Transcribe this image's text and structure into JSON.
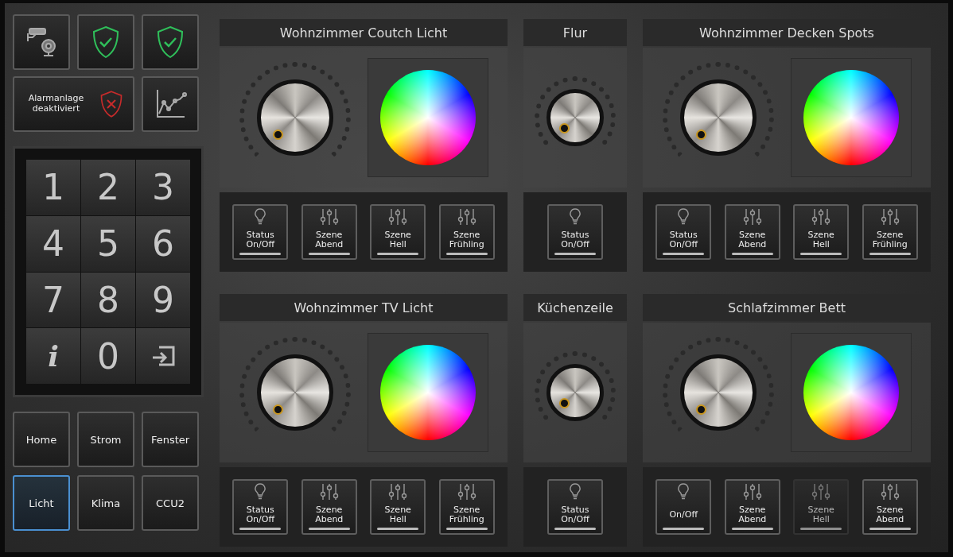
{
  "status_tiles": [
    {
      "kind": "camera"
    },
    {
      "kind": "shield_ok"
    },
    {
      "kind": "shield_ok"
    }
  ],
  "alarm": {
    "label": "Alarmanlage deaktiviert",
    "armed": false
  },
  "keypad": [
    {
      "kind": "digit",
      "label": "1"
    },
    {
      "kind": "digit",
      "label": "2"
    },
    {
      "kind": "digit",
      "label": "3"
    },
    {
      "kind": "digit",
      "label": "4"
    },
    {
      "kind": "digit",
      "label": "5"
    },
    {
      "kind": "digit",
      "label": "6"
    },
    {
      "kind": "digit",
      "label": "7"
    },
    {
      "kind": "digit",
      "label": "8"
    },
    {
      "kind": "digit",
      "label": "9"
    },
    {
      "kind": "info",
      "label": "i"
    },
    {
      "kind": "digit",
      "label": "0"
    },
    {
      "kind": "enter"
    }
  ],
  "nav": [
    {
      "label": "Home",
      "selected": false
    },
    {
      "label": "Strom",
      "selected": false
    },
    {
      "label": "Fenster",
      "selected": false
    },
    {
      "label": "Licht",
      "selected": true
    },
    {
      "label": "Klima",
      "selected": false
    },
    {
      "label": "CCU2",
      "selected": false
    }
  ],
  "rooms": [
    {
      "title": "Wohnzimmer Coutch Licht",
      "color_wheel": true,
      "buttons": [
        {
          "kind": "bulb",
          "label": "Status\nOn/Off",
          "disabled": false
        },
        {
          "kind": "scene",
          "label": "Szene\nAbend",
          "disabled": false
        },
        {
          "kind": "scene",
          "label": "Szene\nHell",
          "disabled": false
        },
        {
          "kind": "scene",
          "label": "Szene\nFrühling",
          "disabled": false
        }
      ]
    },
    {
      "title": "Flur",
      "color_wheel": false,
      "buttons": [
        {
          "kind": "bulb",
          "label": "Status\nOn/Off",
          "disabled": false
        }
      ]
    },
    {
      "title": "Wohnzimmer Decken Spots",
      "color_wheel": true,
      "buttons": [
        {
          "kind": "bulb",
          "label": "Status\nOn/Off",
          "disabled": false
        },
        {
          "kind": "scene",
          "label": "Szene\nAbend",
          "disabled": false
        },
        {
          "kind": "scene",
          "label": "Szene\nHell",
          "disabled": false
        },
        {
          "kind": "scene",
          "label": "Szene\nFrühling",
          "disabled": false
        }
      ]
    },
    {
      "title": "Wohnzimmer TV Licht",
      "color_wheel": true,
      "buttons": [
        {
          "kind": "bulb",
          "label": "Status\nOn/Off",
          "disabled": false
        },
        {
          "kind": "scene",
          "label": "Szene\nAbend",
          "disabled": false
        },
        {
          "kind": "scene",
          "label": "Szene\nHell",
          "disabled": false
        },
        {
          "kind": "scene",
          "label": "Szene\nFrühling",
          "disabled": false
        }
      ]
    },
    {
      "title": "Küchenzeile",
      "color_wheel": false,
      "buttons": [
        {
          "kind": "bulb",
          "label": "Status\nOn/Off",
          "disabled": false
        }
      ]
    },
    {
      "title": "Schlafzimmer Bett",
      "color_wheel": true,
      "buttons": [
        {
          "kind": "bulb",
          "label": "On/Off",
          "disabled": false
        },
        {
          "kind": "scene",
          "label": "Szene\nAbend",
          "disabled": false
        },
        {
          "kind": "scene",
          "label": "Szene\nHell",
          "disabled": true
        },
        {
          "kind": "scene",
          "label": "Szene\nAbend",
          "disabled": false
        }
      ]
    }
  ]
}
